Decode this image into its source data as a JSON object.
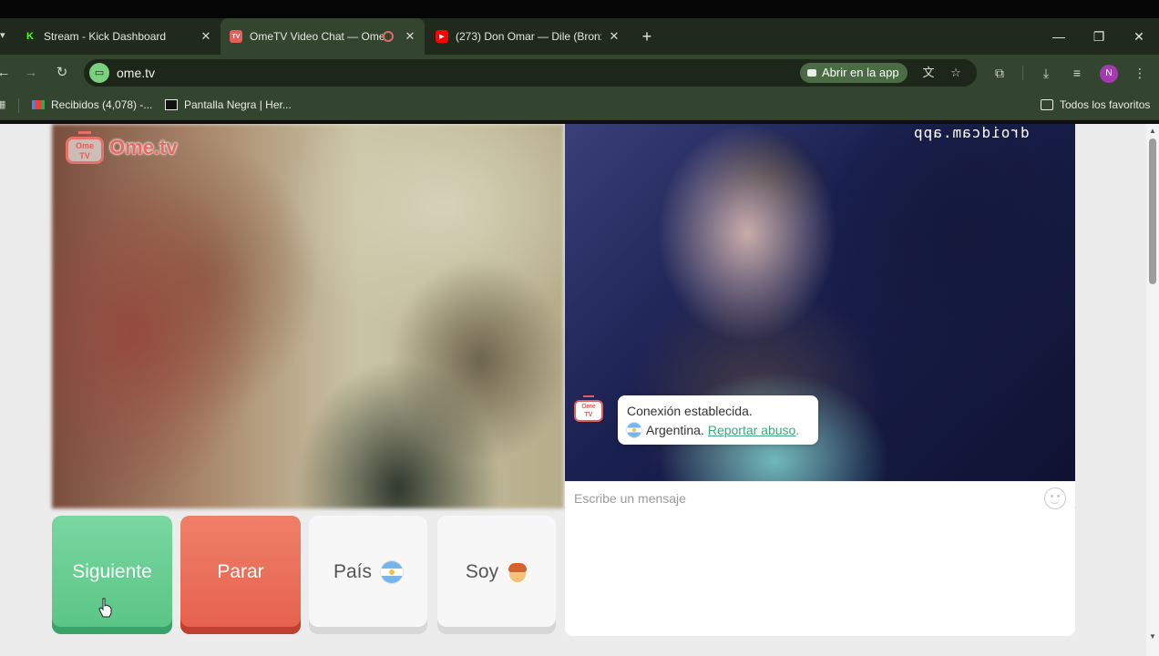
{
  "tabs": [
    {
      "title": "Stream - Kick Dashboard",
      "icon": "kick-icon",
      "color": "#53fc18"
    },
    {
      "title": "OmeTV Video Chat — Ome",
      "icon": "ometv-icon",
      "color": "#e35e57",
      "active": true
    },
    {
      "title": "(273) Don Omar — Dile (Bronx",
      "icon": "youtube-icon",
      "color": "#ff0000"
    }
  ],
  "toolbar": {
    "url": "ome.tv",
    "open_app_label": "Abrir en la app"
  },
  "bookmarks": {
    "items": [
      {
        "label": "Recibidos (4,078) -..."
      },
      {
        "label": "Pantalla Negra | Her..."
      }
    ],
    "all_favorites": "Todos los favoritos"
  },
  "page": {
    "logo_text": "Ome.tv",
    "logo_badge_top": "Ome",
    "logo_badge_bottom": "TV",
    "watermark": "droidcam.app",
    "buttons": {
      "next": "Siguiente",
      "stop": "Parar",
      "country": "País",
      "me": "Soy"
    },
    "chat": {
      "connected": "Conexión establecida.",
      "country": "Argentina.",
      "report": "Reportar abuso",
      "report_suffix": ".",
      "placeholder": "Escribe un mensaje"
    }
  },
  "colors": {
    "next_button": "#58c584",
    "stop_button": "#e5604b",
    "link": "#3fa77c",
    "brand": "#e35e57"
  }
}
